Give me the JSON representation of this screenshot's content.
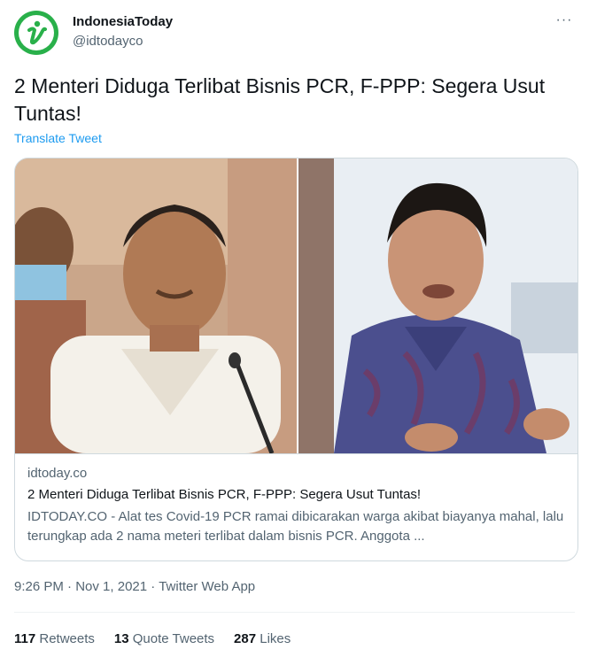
{
  "author": {
    "display_name": "IndonesiaToday",
    "handle": "@idtodayco",
    "avatar_icon": "indonesiatoday-logo",
    "avatar_color": "#29b04a"
  },
  "tweet": {
    "text": "2 Menteri Diduga Terlibat Bisnis PCR, F-PPP: Segera Usut Tuntas!",
    "translate_label": "Translate Tweet"
  },
  "card": {
    "domain": "idtoday.co",
    "title": "2 Menteri Diduga Terlibat Bisnis PCR, F-PPP: Segera Usut Tuntas!",
    "description": "IDTODAY.CO - Alat tes Covid-19 PCR ramai dibicarakan warga akibat biayanya mahal, lalu terungkap ada 2 nama meteri terlibat dalam bisnis PCR. Anggota ..."
  },
  "meta": {
    "time": "9:26 PM",
    "date": "Nov 1, 2021",
    "source": "Twitter Web App",
    "separator": "·"
  },
  "stats": {
    "retweets_count": "117",
    "retweets_label": "Retweets",
    "quotes_count": "13",
    "quotes_label": "Quote Tweets",
    "likes_count": "287",
    "likes_label": "Likes"
  },
  "more_icon": "more-horizontal-icon",
  "colors": {
    "link": "#1d9bf0",
    "secondary_text": "#536471",
    "border": "#cfd9de"
  }
}
